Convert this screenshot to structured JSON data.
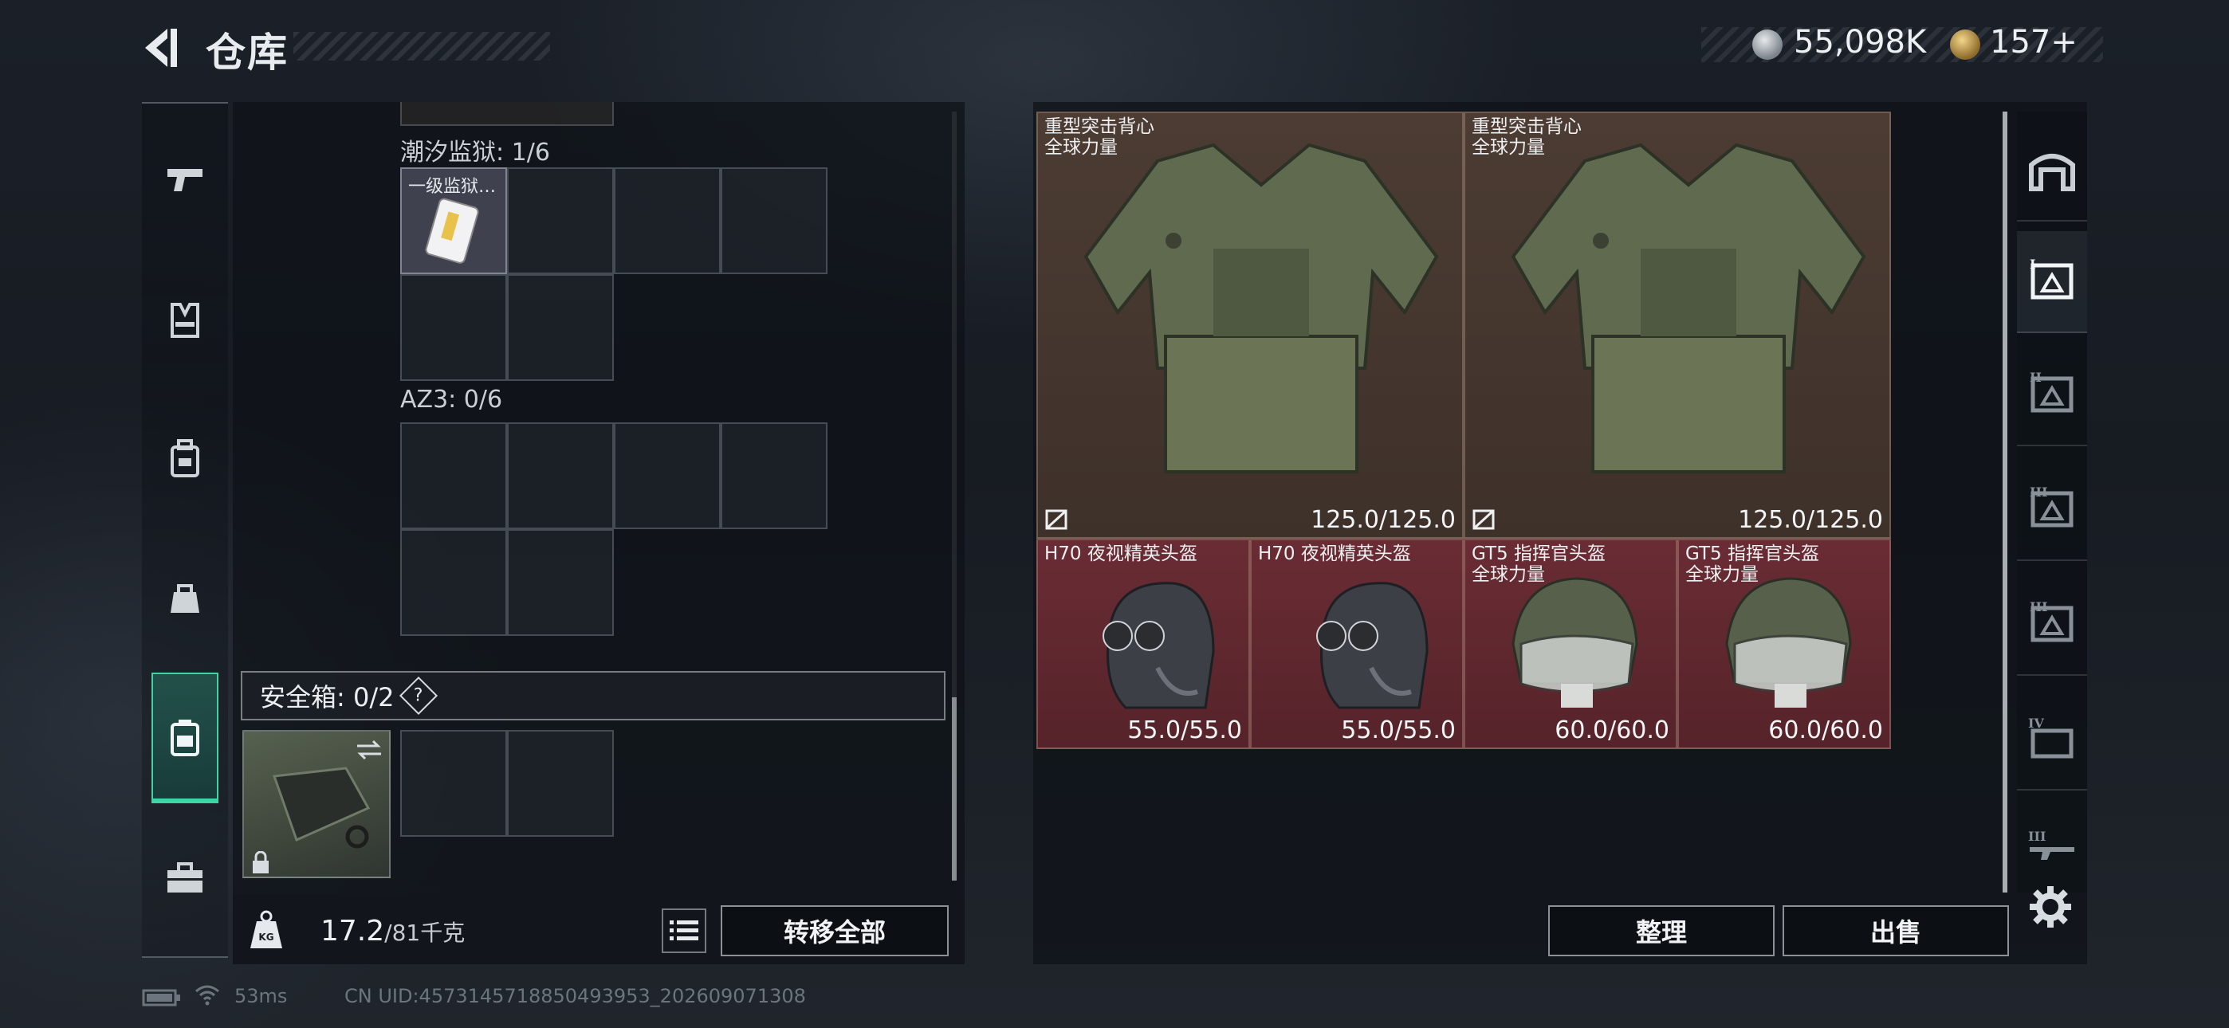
{
  "header": {
    "title": "仓库",
    "currency_silver": "55,098K",
    "currency_gold": "157+"
  },
  "left_tabs": [
    "weapons-icon",
    "armor-icon",
    "backpack-icon",
    "bag-icon",
    "container-icon",
    "toolbox-icon"
  ],
  "containers": {
    "label_1": "潮汐监狱: 1/6",
    "item_1": "一级监狱…",
    "label_2": "AZ3: 0/6"
  },
  "safe_box": {
    "label": "安全箱: 0/2",
    "help": "?"
  },
  "bottom": {
    "weight_value": "17.2",
    "weight_max": "/81千克",
    "transfer_all": "转移全部"
  },
  "stash": {
    "vest_1": {
      "name_line1": "重型突击背心",
      "name_line2": "全球力量",
      "durability": "125.0/125.0"
    },
    "vest_2": {
      "name_line1": "重型突击背心",
      "name_line2": "全球力量",
      "durability": "125.0/125.0"
    },
    "helmet_1": {
      "name_line1": "H70 夜视精英头盔",
      "name_line2": "",
      "durability": "55.0/55.0"
    },
    "helmet_2": {
      "name_line1": "H70 夜视精英头盔",
      "name_line2": "",
      "durability": "55.0/55.0"
    },
    "helmet_3": {
      "name_line1": "GT5 指挥官头盔",
      "name_line2": "全球力量",
      "durability": "60.0/60.0"
    },
    "helmet_4": {
      "name_line1": "GT5 指挥官头盔",
      "name_line2": "全球力量",
      "durability": "60.0/60.0"
    }
  },
  "actions": {
    "sort": "整理",
    "sell": "出售"
  },
  "right_tabs": [
    "I",
    "II",
    "III",
    "III",
    "III",
    "IV",
    "III"
  ],
  "footer": {
    "ping": "53ms",
    "uid": "CN UID:4573145718850493953_202609071308"
  },
  "colors": {
    "accent": "#3fd3a6",
    "vest_bg": "#4c3c33",
    "helmet_bg": "#6a2c34"
  }
}
